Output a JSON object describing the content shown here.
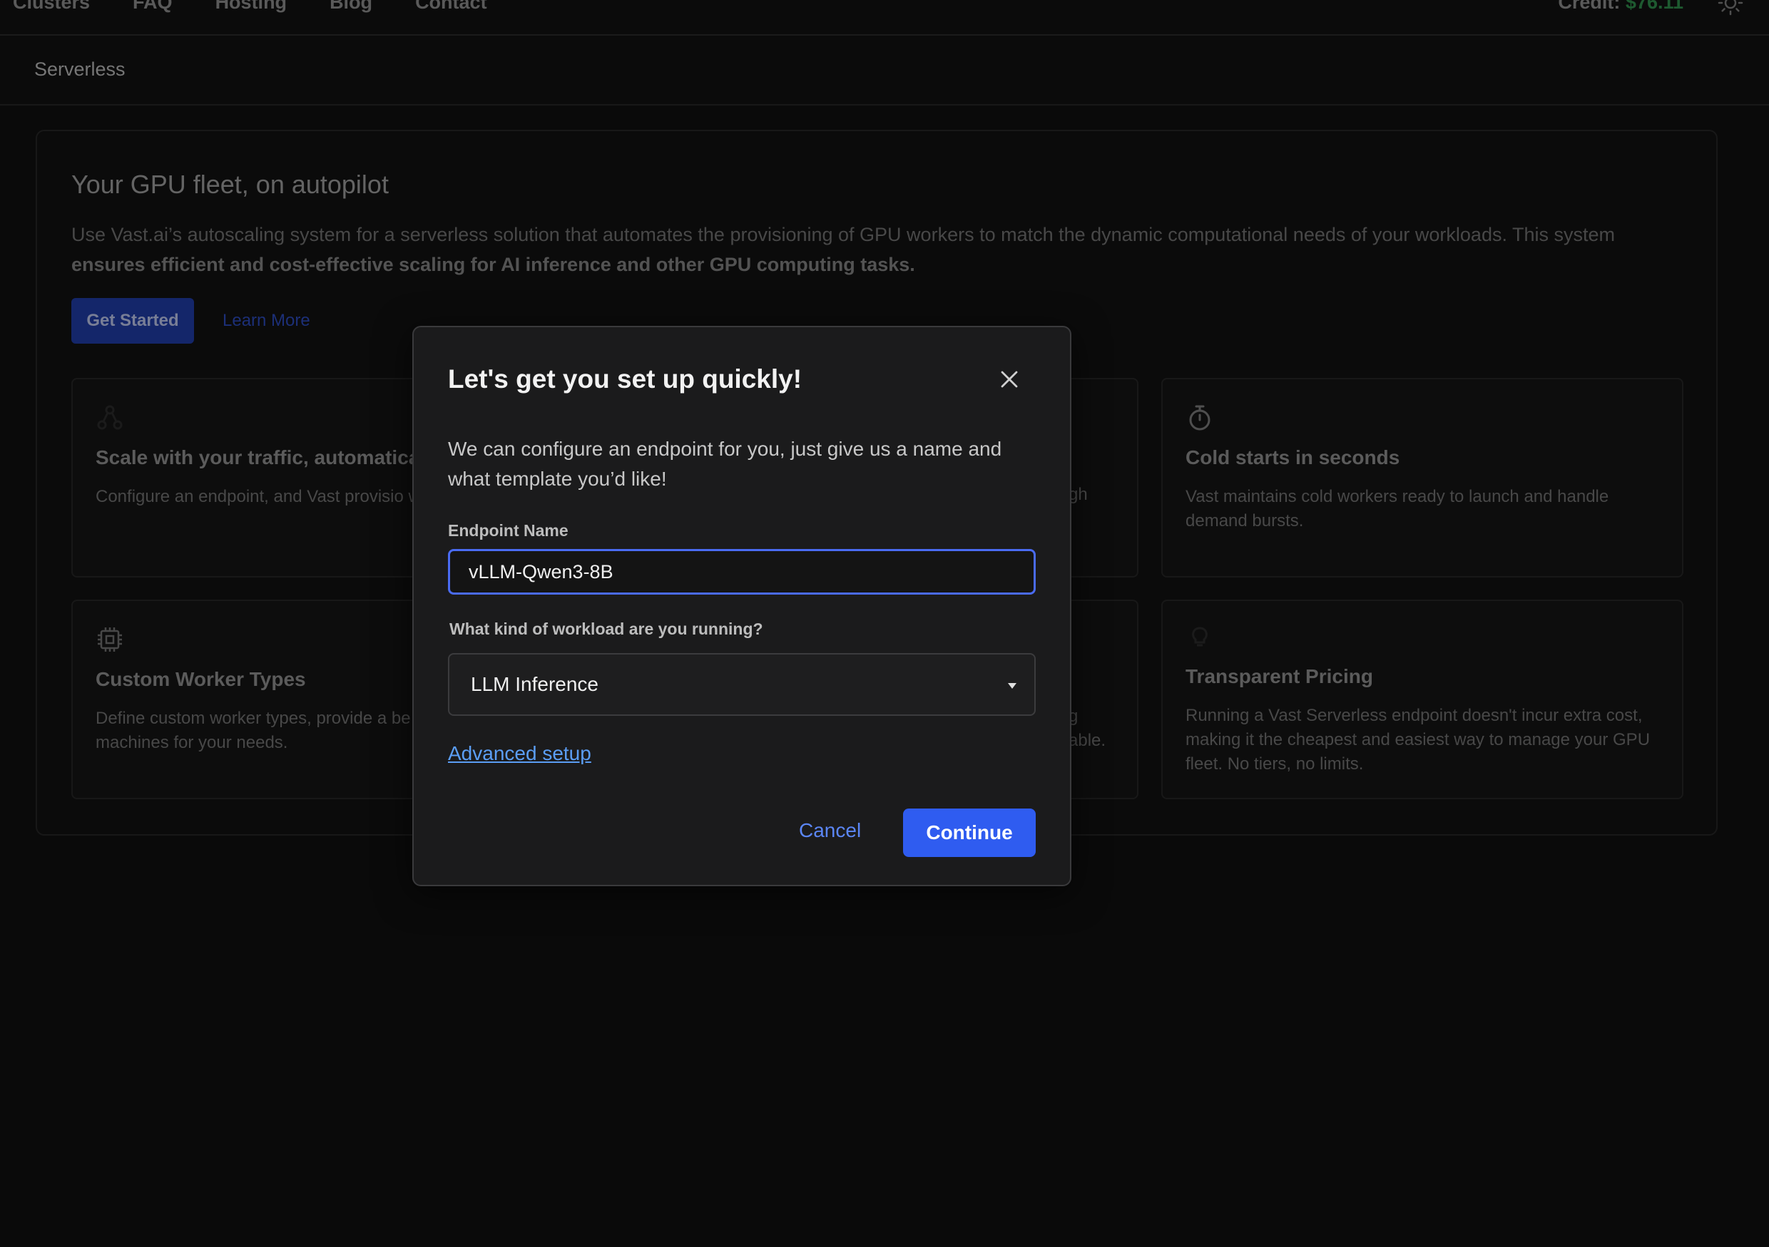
{
  "nav": {
    "links": [
      "Clusters",
      "FAQ",
      "Hosting",
      "Blog",
      "Contact"
    ],
    "credit_label": "Credit: ",
    "credit_amount": "$76.11",
    "theme_icon": "sun-icon"
  },
  "subheader": {
    "breadcrumb": "Serverless"
  },
  "hero": {
    "title": "Your GPU fleet, on autopilot",
    "desc_plain": "Use Vast.ai’s autoscaling system for a serverless solution that automates the provisioning of GPU workers to match the dynamic computational needs of your workloads. This system ",
    "desc_bold": "ensures efficient and cost-effective scaling for AI inference and other GPU computing tasks.",
    "get_started": "Get Started",
    "learn_more": "Learn More"
  },
  "features": {
    "scale": {
      "icon": "network-icon",
      "title": "Scale with your traffic, automatica",
      "text": "Configure an endpoint, and Vast provisio workers as load shifts."
    },
    "cold": {
      "icon": "stopwatch-icon",
      "title": "Cold starts in seconds",
      "text": "Vast maintains cold workers ready to launch and handle demand bursts."
    },
    "custom": {
      "icon": "chip-icon",
      "title": "Custom Worker Types",
      "text": "Define custom worker types, provide a be find the best machines for your needs."
    },
    "pricing": {
      "icon": "lightbulb-icon",
      "title": "Transparent Pricing",
      "text": "Running a Vast Serverless endpoint doesn't incur extra cost, making it the cheapest and easiest way to manage your GPU fleet. No tiers, no limits."
    },
    "partial_middle_top": "gh",
    "partial_middle_bottom_1": "g",
    "partial_middle_bottom_2": "able."
  },
  "modal": {
    "title": "Let's get you set up quickly!",
    "description": "We can configure an endpoint for you, just give us a name and what template you’d like!",
    "endpoint_label": "Endpoint Name",
    "endpoint_value": "vLLM-Qwen3-8B",
    "workload_label": "What kind of workload are you running?",
    "workload_value": "LLM Inference",
    "advanced_link": "Advanced setup",
    "cancel": "Cancel",
    "continue": "Continue"
  },
  "colors": {
    "accent": "#2f5cf0",
    "link": "#5b9ef5",
    "credit": "#2e8b4a"
  }
}
